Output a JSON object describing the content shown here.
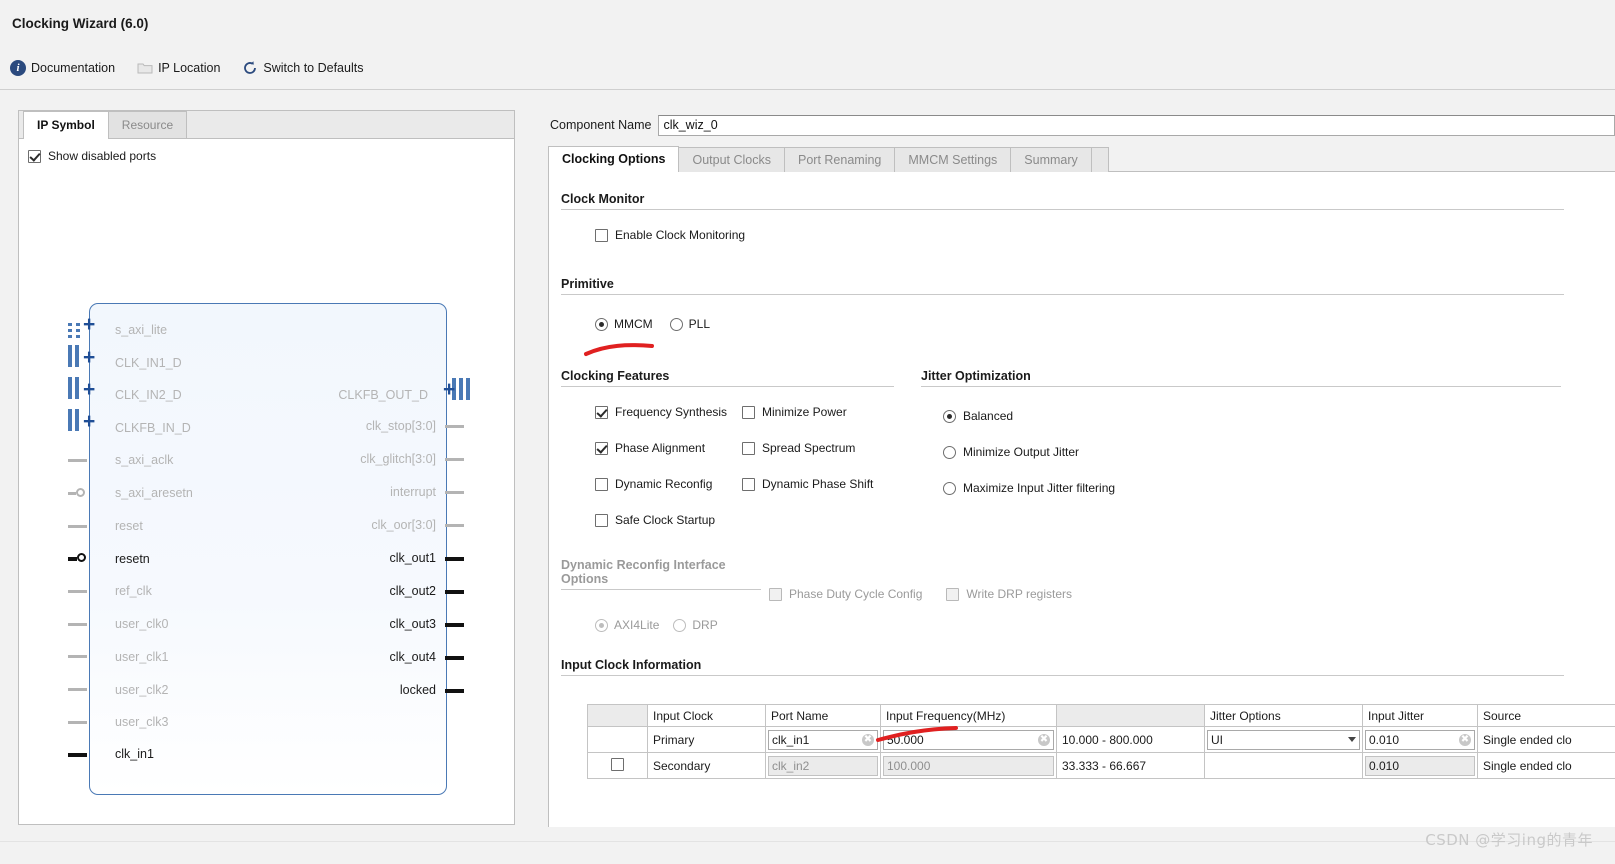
{
  "window": {
    "title": "Clocking Wizard (6.0)"
  },
  "toolbar": {
    "items": [
      {
        "label": "Documentation",
        "icon": "info-icon"
      },
      {
        "label": "IP Location",
        "icon": "folder-icon"
      },
      {
        "label": "Switch to Defaults",
        "icon": "refresh-icon"
      }
    ]
  },
  "left_panel": {
    "tabs": [
      {
        "label": "IP Symbol",
        "active": true
      },
      {
        "label": "Resource",
        "active": false
      }
    ],
    "show_disabled_ports": {
      "label": "Show disabled ports",
      "checked": true
    },
    "symbol": {
      "left_ports": [
        {
          "name": "s_axi_lite",
          "enabled": false,
          "kind": "bus-group"
        },
        {
          "name": "CLK_IN1_D",
          "enabled": false,
          "kind": "bus-group"
        },
        {
          "name": "CLK_IN2_D",
          "enabled": false,
          "kind": "bus-group"
        },
        {
          "name": "CLKFB_IN_D",
          "enabled": false,
          "kind": "bus-group"
        },
        {
          "name": "s_axi_aclk",
          "enabled": false,
          "kind": "wire"
        },
        {
          "name": "s_axi_aresetn",
          "enabled": false,
          "kind": "wire-inverted"
        },
        {
          "name": "reset",
          "enabled": false,
          "kind": "wire"
        },
        {
          "name": "resetn",
          "enabled": true,
          "kind": "wire-inverted"
        },
        {
          "name": "ref_clk",
          "enabled": false,
          "kind": "wire"
        },
        {
          "name": "user_clk0",
          "enabled": false,
          "kind": "wire"
        },
        {
          "name": "user_clk1",
          "enabled": false,
          "kind": "wire"
        },
        {
          "name": "user_clk2",
          "enabled": false,
          "kind": "wire"
        },
        {
          "name": "user_clk3",
          "enabled": false,
          "kind": "wire"
        },
        {
          "name": "clk_in1",
          "enabled": true,
          "kind": "wire"
        }
      ],
      "right_ports": [
        {
          "name": "CLKFB_OUT_D",
          "enabled": false,
          "kind": "bus-group"
        },
        {
          "name": "clk_stop[3:0]",
          "enabled": false,
          "kind": "wire"
        },
        {
          "name": "clk_glitch[3:0]",
          "enabled": false,
          "kind": "wire"
        },
        {
          "name": "interrupt",
          "enabled": false,
          "kind": "wire"
        },
        {
          "name": "clk_oor[3:0]",
          "enabled": false,
          "kind": "wire"
        },
        {
          "name": "clk_out1",
          "enabled": true,
          "kind": "wire"
        },
        {
          "name": "clk_out2",
          "enabled": true,
          "kind": "wire"
        },
        {
          "name": "clk_out3",
          "enabled": true,
          "kind": "wire"
        },
        {
          "name": "clk_out4",
          "enabled": true,
          "kind": "wire"
        },
        {
          "name": "locked",
          "enabled": true,
          "kind": "wire"
        }
      ]
    }
  },
  "right_panel": {
    "component_name": {
      "label": "Component Name",
      "value": "clk_wiz_0"
    },
    "tabs": [
      {
        "label": "Clocking Options",
        "active": true
      },
      {
        "label": "Output Clocks",
        "active": false
      },
      {
        "label": "Port Renaming",
        "active": false
      },
      {
        "label": "MMCM Settings",
        "active": false
      },
      {
        "label": "Summary",
        "active": false
      }
    ],
    "clock_monitor": {
      "title": "Clock Monitor",
      "enable": {
        "label": "Enable Clock Monitoring",
        "checked": false
      }
    },
    "primitive": {
      "title": "Primitive",
      "options": [
        {
          "label": "MMCM",
          "selected": true
        },
        {
          "label": "PLL",
          "selected": false
        }
      ]
    },
    "clocking_features": {
      "title": "Clocking Features",
      "col1": [
        {
          "label": "Frequency Synthesis",
          "checked": true
        },
        {
          "label": "Phase Alignment",
          "checked": true
        },
        {
          "label": "Dynamic Reconfig",
          "checked": false
        },
        {
          "label": "Safe Clock Startup",
          "checked": false
        }
      ],
      "col2": [
        {
          "label": "Minimize Power",
          "checked": false
        },
        {
          "label": "Spread Spectrum",
          "checked": false
        },
        {
          "label": "Dynamic Phase Shift",
          "checked": false
        }
      ]
    },
    "jitter_optimization": {
      "title": "Jitter Optimization",
      "options": [
        {
          "label": "Balanced",
          "selected": true
        },
        {
          "label": "Minimize Output Jitter",
          "selected": false
        },
        {
          "label": "Maximize Input Jitter filtering",
          "selected": false
        }
      ]
    },
    "dynamic_reconfig": {
      "title": "Dynamic Reconfig Interface Options",
      "radios": [
        {
          "label": "AXI4Lite",
          "selected": true,
          "disabled": true
        },
        {
          "label": "DRP",
          "selected": false,
          "disabled": true
        }
      ],
      "checks": [
        {
          "label": "Phase Duty Cycle Config",
          "checked": false,
          "disabled": true
        },
        {
          "label": "Write DRP registers",
          "checked": false,
          "disabled": true
        }
      ]
    },
    "input_clock_information": {
      "title": "Input Clock Information",
      "columns": [
        "",
        "Input Clock",
        "Port Name",
        "Input Frequency(MHz)",
        "",
        "Jitter Options",
        "Input Jitter",
        "Source"
      ],
      "rows": [
        {
          "checkbox": null,
          "input_clock": "Primary",
          "port_name": "clk_in1",
          "input_frequency": "50.000",
          "range": "10.000 - 800.000",
          "jitter_options": "UI",
          "input_jitter": "0.010",
          "source": "Single ended clo",
          "disabled": false
        },
        {
          "checkbox": false,
          "input_clock": "Secondary",
          "port_name": "clk_in2",
          "input_frequency": "100.000",
          "range": "33.333 - 66.667",
          "jitter_options": "",
          "input_jitter": "0.010",
          "source": "Single ended clo",
          "disabled": true
        }
      ]
    }
  },
  "watermark": {
    "text": "CSDN @学习ing的青年"
  }
}
